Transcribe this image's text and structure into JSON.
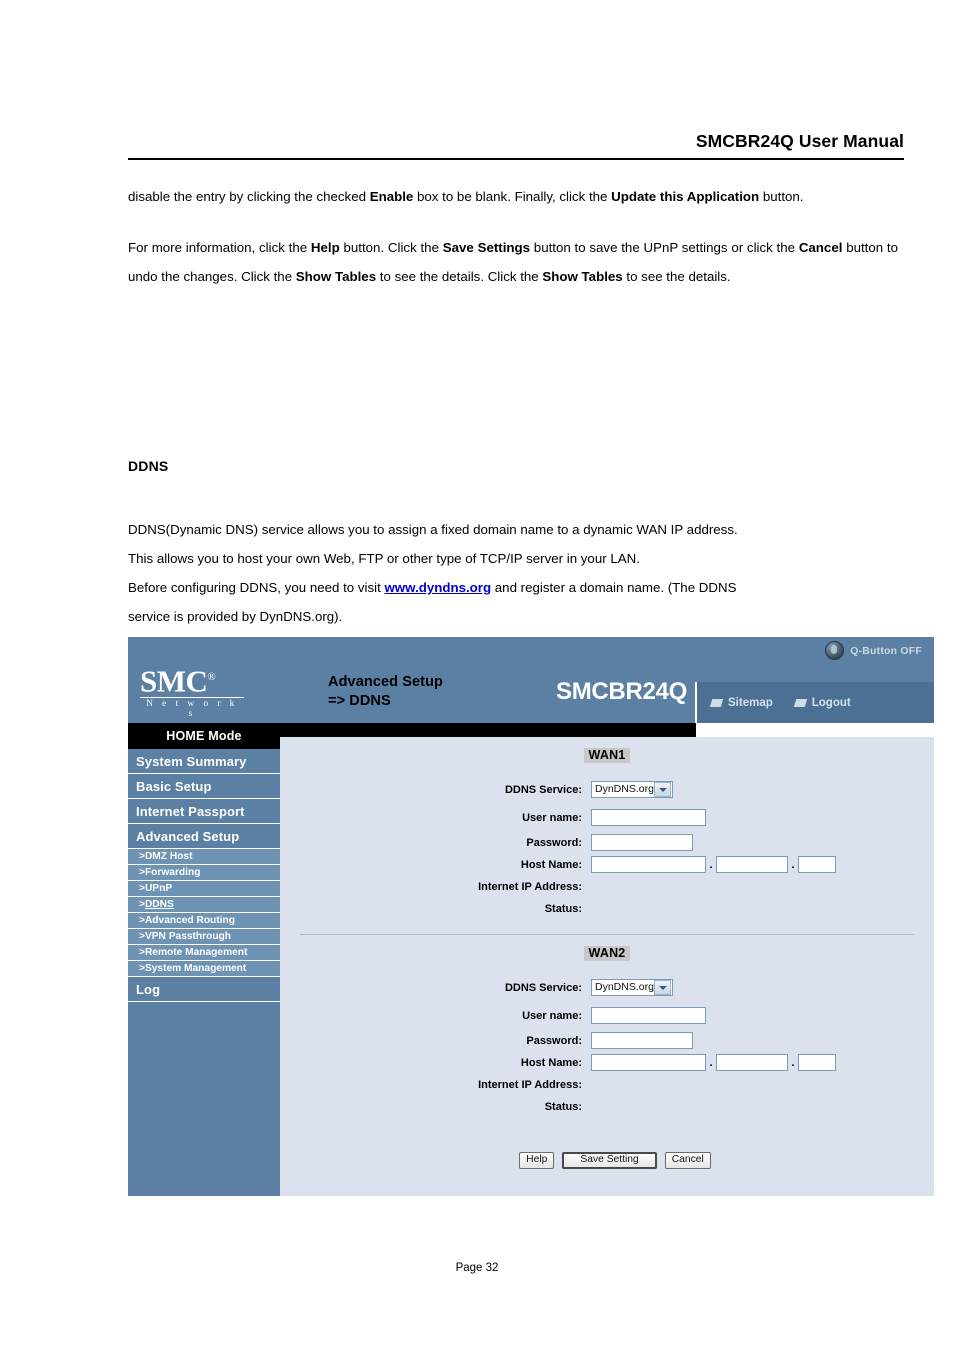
{
  "document": {
    "header_title": "SMCBR24Q User Manual",
    "footer": "Page 32",
    "paragraph_1": {
      "t1": "disable the entry by clicking the checked ",
      "b1": "Enable",
      "t2": " box to be blank. Finally, click the ",
      "b2": "Update this Application",
      "t3": " button."
    },
    "paragraph_2": {
      "t1": "For more information, click the ",
      "b1": "Help",
      "t2": " button. Click the ",
      "b2": "Save Settings",
      "t3": " button to save the UPnP settings or click the ",
      "b3": "Cancel",
      "t4": " button to undo the changes. Click the ",
      "b4": "Show Tables",
      "t5": " to see the details. Click the ",
      "b5": "Show Tables",
      "t6": " to see the details."
    },
    "ddns_section": {
      "heading": "DDNS",
      "line_1": "DDNS(Dynamic DNS) service allows you to assign a fixed domain name to a dynamic WAN IP address.",
      "line_2": "This allows you to host your own Web, FTP or other type of TCP/IP server in your LAN.",
      "line_3_pre": "Before configuring DDNS, you need to visit ",
      "line_3_link": "www.dyndns.org",
      "line_3_post": " and register a domain name. (The DDNS",
      "line_4": "service is provided by DynDNS.org)."
    }
  },
  "router_ui": {
    "brand": {
      "logo_main": "SMC",
      "logo_reg": "®",
      "logo_sub": "N e t w o r k s"
    },
    "header": {
      "page_title_line1": "Advanced Setup",
      "page_title_line2": "=> DDNS",
      "model": "SMCBR24Q",
      "q_button_label": "Q-Button OFF",
      "nav": [
        {
          "label": "Sitemap",
          "icon": "parallelogram-icon"
        },
        {
          "label": "Logout",
          "icon": "parallelogram-icon"
        }
      ]
    },
    "sidebar": {
      "mode_label": "HOME Mode",
      "main_items": [
        {
          "label": "System Summary"
        },
        {
          "label": "Basic Setup"
        },
        {
          "label": "Internet Passport"
        },
        {
          "label": "Advanced Setup"
        }
      ],
      "sub_items": [
        {
          "label": "DMZ Host",
          "active": false
        },
        {
          "label": "Forwarding",
          "active": false
        },
        {
          "label": "UPnP",
          "active": false
        },
        {
          "label": "DDNS",
          "active": true
        },
        {
          "label": "Advanced Routing",
          "active": false
        },
        {
          "label": "VPN Passthrough",
          "active": false
        },
        {
          "label": "Remote Management",
          "active": false
        },
        {
          "label": "System Management",
          "active": false
        }
      ],
      "log_item": {
        "label": "Log"
      },
      "prefix": "> "
    },
    "sections": [
      {
        "title": "WAN1",
        "fields": {
          "ddns_service_label": "DDNS Service:",
          "ddns_service_value": "DynDNS.org",
          "user_name_label": "User name:",
          "user_name_value": "",
          "password_label": "Password:",
          "password_value": "",
          "host_name_label": "Host Name:",
          "host_part_1": "",
          "host_part_2": "",
          "host_part_3": "",
          "host_separator": ".",
          "internet_ip_label": "Internet IP Address:",
          "internet_ip_value": "",
          "status_label": "Status:",
          "status_value": ""
        }
      },
      {
        "title": "WAN2",
        "fields": {
          "ddns_service_label": "DDNS Service:",
          "ddns_service_value": "DynDNS.org",
          "user_name_label": "User name:",
          "user_name_value": "",
          "password_label": "Password:",
          "password_value": "",
          "host_name_label": "Host Name:",
          "host_part_1": "",
          "host_part_2": "",
          "host_part_3": "",
          "host_separator": ".",
          "internet_ip_label": "Internet IP Address:",
          "internet_ip_value": "",
          "status_label": "Status:",
          "status_value": ""
        }
      }
    ],
    "buttons": {
      "help": "Help",
      "save": "Save Setting",
      "cancel": "Cancel"
    },
    "colors": {
      "header_blue": "#5b80a4",
      "nav_blue": "#4b7093",
      "sub_blue": "#6f93b3",
      "content_bg": "#dbe2ed",
      "divider": "#b4b6dc",
      "badge_gray": "#c8c8c8",
      "link_blue": "#0000cc"
    }
  }
}
